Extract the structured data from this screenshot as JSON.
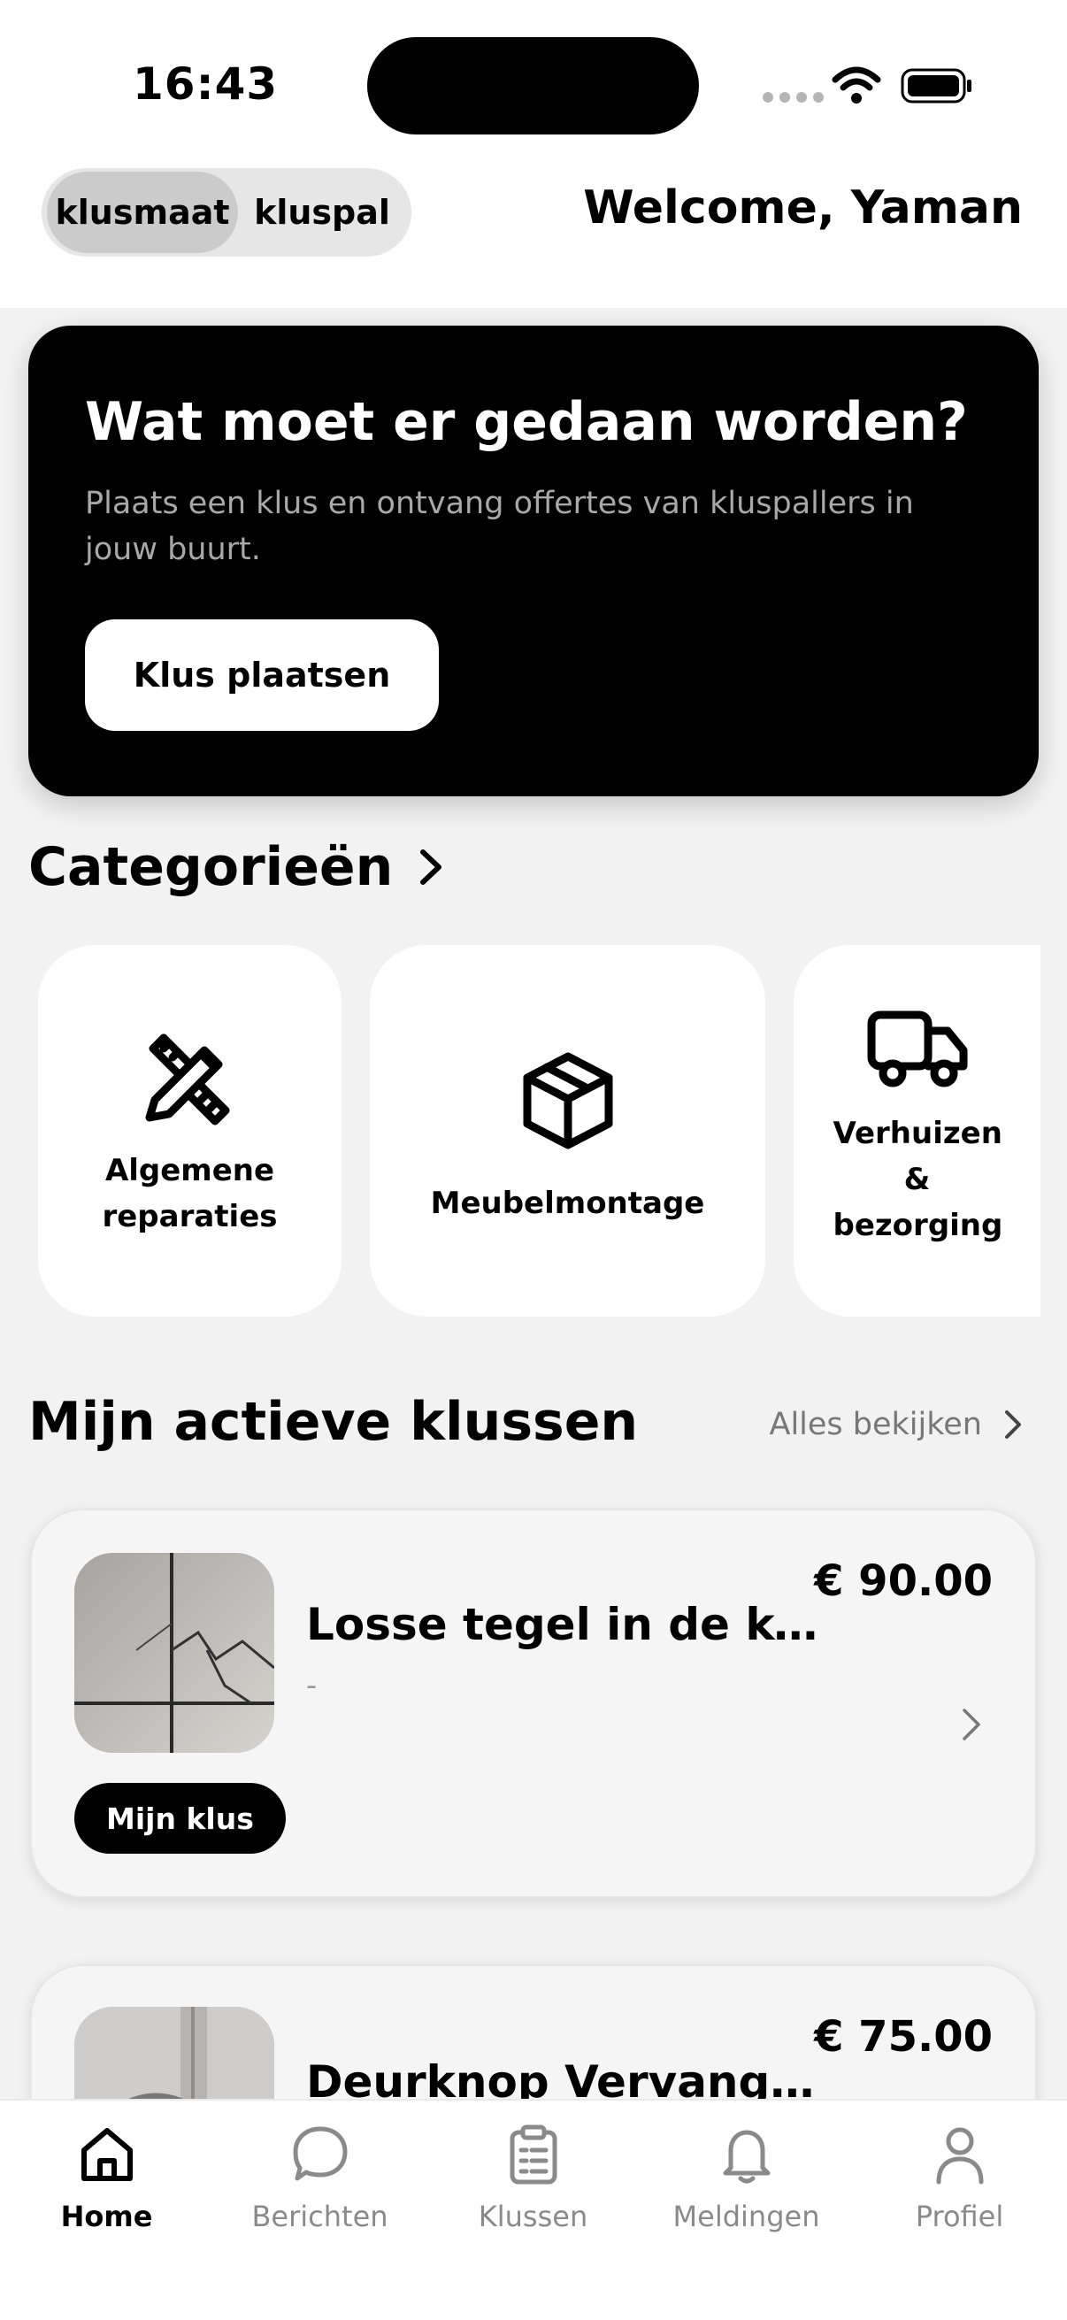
{
  "status_bar": {
    "time": "16:43"
  },
  "header": {
    "toggle": {
      "options": [
        "klusmaat",
        "kluspal"
      ],
      "selected": "klusmaat"
    },
    "welcome": "Welcome, Yaman"
  },
  "hero": {
    "title": "Wat moet er gedaan worden?",
    "subtitle": "Plaats een klus en ontvang offertes van kluspallers in jouw buurt.",
    "cta_label": "Klus plaatsen"
  },
  "categories": {
    "title": "Categorieën",
    "items": [
      {
        "label": "Algemene reparaties",
        "icon": "tools-icon"
      },
      {
        "label": "Meubelmontage",
        "icon": "box-icon"
      },
      {
        "label": "Verhuizen & bezorging",
        "icon": "truck-icon"
      }
    ]
  },
  "active_jobs": {
    "title": "Mijn actieve klussen",
    "see_all": "Alles bekijken",
    "items": [
      {
        "title": "Losse tegel in de keu...",
        "subtitle": "-",
        "price": "€ 90.00",
        "badge": "Mijn klus"
      },
      {
        "title": "Deurknop Vervangen...",
        "price": "€ 75.00"
      }
    ]
  },
  "tabbar": {
    "items": [
      {
        "label": "Home",
        "icon": "home-icon",
        "active": true
      },
      {
        "label": "Berichten",
        "icon": "chat-icon"
      },
      {
        "label": "Klussen",
        "icon": "clipboard-icon"
      },
      {
        "label": "Meldingen",
        "icon": "bell-icon"
      },
      {
        "label": "Profiel",
        "icon": "user-icon"
      }
    ]
  }
}
